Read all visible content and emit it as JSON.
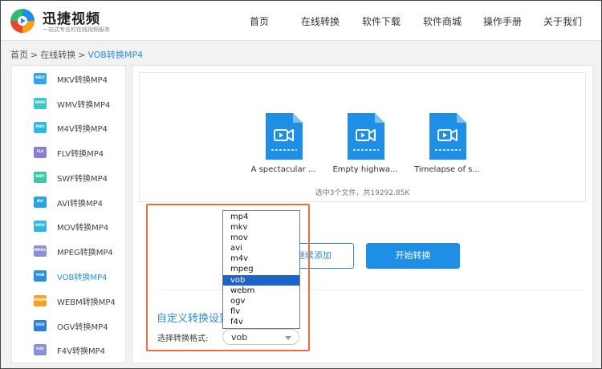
{
  "brand": {
    "name": "迅捷视频",
    "slogan": "一站式专业的在线视频服务",
    "colors": {
      "accent": "#2a8fdc",
      "highlight": "#ef6a3e",
      "selected_option": "#1e63c7"
    }
  },
  "nav": {
    "items": [
      "首页",
      "在线转换",
      "软件下载",
      "软件商城",
      "操作手册",
      "关于我们"
    ]
  },
  "breadcrumb": {
    "items": [
      "首页",
      "在线转换"
    ],
    "current": "VOB转换MP4",
    "separator": ">"
  },
  "sidebar": {
    "items": [
      {
        "icon_text": "MKV",
        "label": "MKV转换MP4",
        "color": "#2fa7e8",
        "icon": "mkv-file-icon"
      },
      {
        "icon_text": "WMV",
        "label": "WMV转换MP4",
        "color": "#3dc8c6",
        "icon": "wmv-file-icon"
      },
      {
        "icon_text": "M4V",
        "label": "M4V转换MP4",
        "color": "#2fb7e8",
        "icon": "m4v-file-icon"
      },
      {
        "icon_text": "FLV",
        "label": "FLV转换MP4",
        "color": "#8a7bd8",
        "icon": "flv-file-icon"
      },
      {
        "icon_text": "SWF",
        "label": "SWF转换MP4",
        "color": "#3bc7a8",
        "icon": "swf-file-icon"
      },
      {
        "icon_text": "AVI",
        "label": "AVI转换MP4",
        "color": "#25a4e6",
        "icon": "avi-file-icon"
      },
      {
        "icon_text": "MOV",
        "label": "MOV转换MP4",
        "color": "#2fb7e8",
        "icon": "mov-file-icon"
      },
      {
        "icon_text": "MPEG",
        "label": "MPEG转换MP4",
        "color": "#8a8fd8",
        "icon": "mpeg-file-icon"
      },
      {
        "icon_text": "VOB",
        "label": "VOB转换MP4",
        "color": "#2a8fdc",
        "icon": "vob-file-icon",
        "active": true
      },
      {
        "icon_text": "WEBM",
        "label": "WEBM转换MP4",
        "color": "#f5a020",
        "icon": "webm-file-icon"
      },
      {
        "icon_text": "OGV",
        "label": "OGV转换MP4",
        "color": "#2a7fdc",
        "icon": "ogv-file-icon"
      },
      {
        "icon_text": "F4V",
        "label": "F4V转换MP4",
        "color": "#8a8fd8",
        "icon": "f4v-file-icon"
      }
    ]
  },
  "files": {
    "items": [
      {
        "name": "A spectacular ...",
        "icon": "video-file-icon"
      },
      {
        "name": "Empty highwa...",
        "icon": "video-file-icon"
      },
      {
        "name": "Timelapse of s...",
        "icon": "video-file-icon"
      }
    ],
    "summary": "选中3个文件，共19292.85K"
  },
  "actions": {
    "add_label": "继续添加",
    "start_label": "开始转换"
  },
  "settings": {
    "title": "自定义转换设置",
    "format_label": "选择转换格式:",
    "selected_format": "vob",
    "options": [
      "mp4",
      "mkv",
      "mov",
      "avi",
      "m4v",
      "mpeg",
      "vob",
      "webm",
      "ogv",
      "flv",
      "f4v"
    ],
    "selected_index": 6
  }
}
